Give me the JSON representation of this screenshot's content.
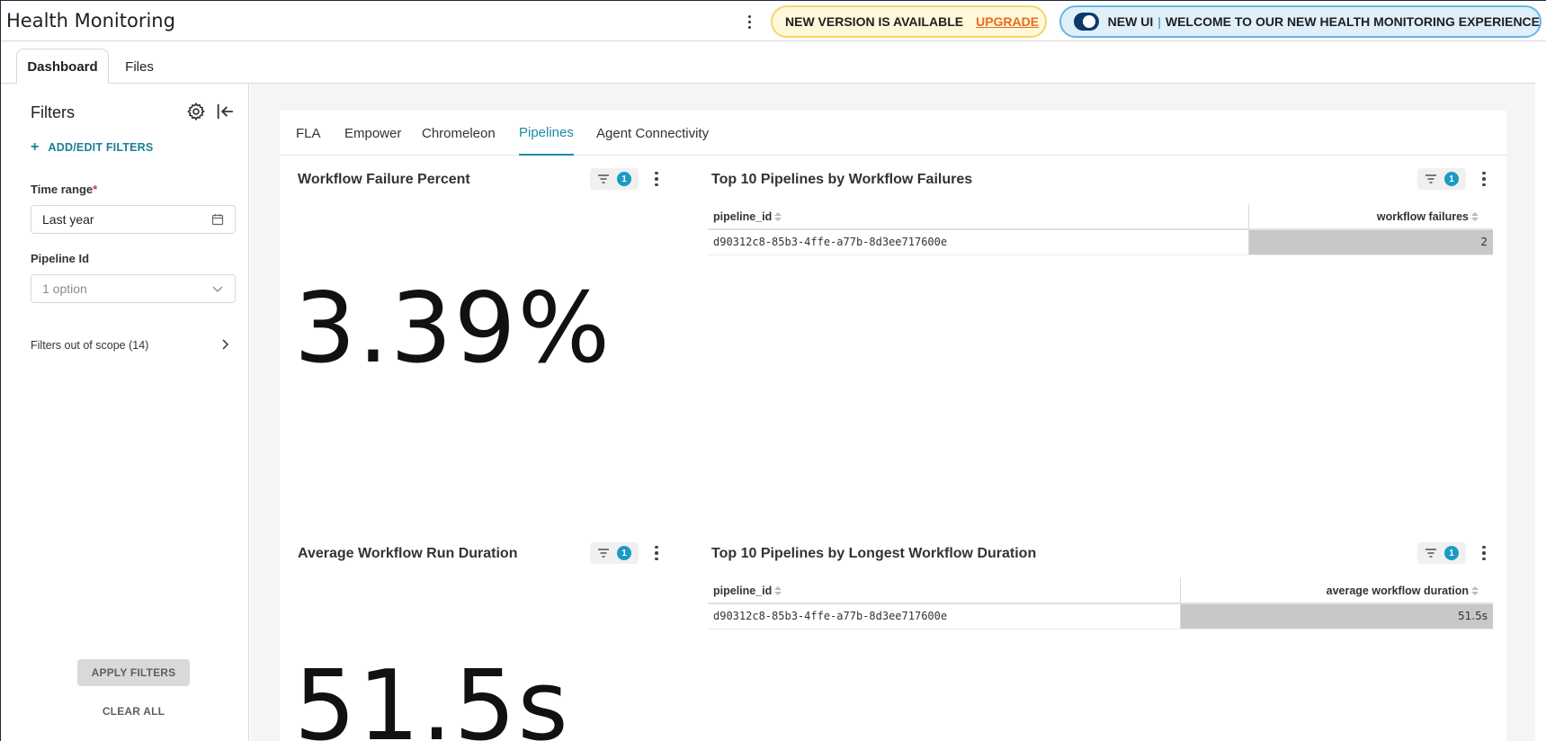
{
  "header": {
    "app_title": "Health Monitoring",
    "version_banner": {
      "text": "NEW VERSION IS AVAILABLE",
      "action": "UPGRADE"
    },
    "newui_banner": {
      "label": "NEW UI",
      "separator": "|",
      "message": "WELCOME TO OUR NEW HEALTH MONITORING EXPERIENCE",
      "toggle_on": true
    }
  },
  "page_tabs": [
    {
      "label": "Dashboard",
      "active": true
    },
    {
      "label": "Files",
      "active": false
    }
  ],
  "sidebar": {
    "title": "Filters",
    "add_filters_label": "ADD/EDIT FILTERS",
    "time_range": {
      "label": "Time range",
      "required_mark": "*",
      "value": "Last year"
    },
    "pipeline_id": {
      "label": "Pipeline Id",
      "placeholder": "1 option"
    },
    "out_of_scope": "Filters out of scope (14)",
    "apply_label": "APPLY FILTERS",
    "clear_label": "CLEAR ALL"
  },
  "dashboard_tabs": [
    {
      "label": "FLA",
      "active": false
    },
    {
      "label": "Empower",
      "active": false
    },
    {
      "label": "Chromeleon",
      "active": false
    },
    {
      "label": "Pipelines",
      "active": true
    },
    {
      "label": "Agent Connectivity",
      "active": false
    }
  ],
  "charts": {
    "failure_percent": {
      "title": "Workflow Failure Percent",
      "filter_count": "1",
      "value": "3.39%"
    },
    "top_failures": {
      "title": "Top 10 Pipelines by Workflow Failures",
      "filter_count": "1",
      "columns": [
        "pipeline_id",
        "workflow failures"
      ],
      "rows": [
        {
          "pipeline_id": "d90312c8-85b3-4ffe-a77b-8d3ee717600e",
          "value": "2"
        }
      ]
    },
    "avg_duration": {
      "title": "Average Workflow Run Duration",
      "filter_count": "1",
      "value": "51.5s"
    },
    "top_duration": {
      "title": "Top 10 Pipelines by Longest Workflow Duration",
      "filter_count": "1",
      "columns": [
        "pipeline_id",
        "average workflow duration"
      ],
      "rows": [
        {
          "pipeline_id": "d90312c8-85b3-4ffe-a77b-8d3ee717600e",
          "value": "51.5s"
        }
      ]
    }
  },
  "colors": {
    "accent": "#1b8aa6",
    "badge": "#1b9ac4",
    "upgrade": "#e86b1c",
    "toggle": "#0d3a6b"
  }
}
